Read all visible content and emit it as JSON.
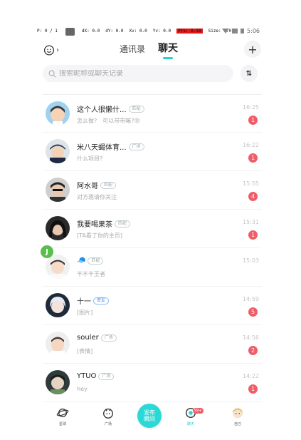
{
  "debug": {
    "p": "P: 0 / 1",
    "dx": "dX: 0.0",
    "dy": "dY: 0.0",
    "xv": "Xv: 0.0",
    "yv": "Yv: 0.0",
    "prs": "Prs: 0.50",
    "size": "Size: 0.0"
  },
  "status": {
    "time": "5:06"
  },
  "header": {
    "tab_contacts": "通讯录",
    "tab_chat": "聊天",
    "plus": "+"
  },
  "search": {
    "placeholder": "搜索昵称或聊天记录",
    "sort": "⇅"
  },
  "accent": "#25d4d0",
  "badge_color": "#ef5e66",
  "conversations": [
    {
      "name": "这个人很懒什...",
      "tag": "匹配",
      "message": "怎么做?　可以带带嘛?😝",
      "time": "16:25",
      "unread": "1",
      "avatar": "cartoon-boy"
    },
    {
      "name": "米八天蝎体育...",
      "tag": "广场",
      "message": "什么项目?",
      "time": "16:22",
      "unread": "1",
      "avatar": "boy-cap"
    },
    {
      "name": "阿水哥",
      "tag": "匹配",
      "message": "对方邀请你关注",
      "time": "15:55",
      "unread": "4",
      "avatar": "boy-sunglasses"
    },
    {
      "name": "我要喝果茶",
      "tag": "匹配",
      "message": "[TA看了你的主页]",
      "time": "15:31",
      "unread": "1",
      "avatar": "girl-dark"
    },
    {
      "name": "🧢",
      "tag": "匹配",
      "message": "干不干王者",
      "time": "15:03",
      "unread": "",
      "avatar": "boy-light"
    },
    {
      "name": "十一",
      "tag": "密友",
      "message": "[图片]",
      "time": "14:59",
      "unread": "5",
      "avatar": "anime-white"
    },
    {
      "name": "souler",
      "tag": "广场",
      "message": "[表情]",
      "time": "14:56",
      "unread": "2",
      "avatar": "boy-plain"
    },
    {
      "name": "YTUO",
      "tag": "广场",
      "message": "hey",
      "time": "14:22",
      "unread": "1",
      "avatar": "boy-sketch"
    }
  ],
  "floating": {
    "label": "J"
  },
  "nav": {
    "planet": "星球",
    "square": "广场",
    "publish": "发布\n瞬间",
    "chat": "聊天",
    "chat_badge": "99+",
    "me": "自己"
  }
}
